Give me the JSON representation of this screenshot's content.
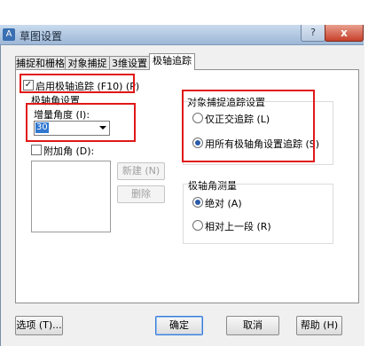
{
  "window": {
    "title": "草图设置",
    "app_icon_glyph": "A",
    "help_glyph": "?",
    "close_glyph": "x"
  },
  "tabs": [
    {
      "label": "捕捉和栅格"
    },
    {
      "label": "对象捕捉"
    },
    {
      "label": "3维设置"
    },
    {
      "label": "极轴追踪"
    }
  ],
  "active_tab": "极轴追踪",
  "polar": {
    "enable_label": "启用极轴追踪 (F10) (P)",
    "enable_checked": true,
    "check_glyph": "✓",
    "angle_settings_group": "极轴角设置",
    "increment_label": "增量角度 (I):",
    "increment_value": "30",
    "additional_label": "附加角 (D):",
    "additional_checked": false,
    "new_button": "新建 (N)",
    "delete_button": "删除"
  },
  "object_snap_tracking": {
    "group_label": "对象捕捉追踪设置",
    "orthogonal_label": "仅正交追踪 (L)",
    "all_polar_label": "用所有极轴角设置追踪 (S)",
    "selected": "all_polar"
  },
  "polar_measurement": {
    "group_label": "极轴角测量",
    "absolute_label": "绝对 (A)",
    "relative_label": "相对上一段 (R)",
    "selected": "absolute"
  },
  "footer": {
    "options_button": "选项 (T)...",
    "ok_button": "确定",
    "cancel_button": "取消",
    "help_button": "帮助 (H)"
  },
  "colors": {
    "highlight_box": "#e01818",
    "selection": "#3078d0",
    "titlebar": "#9db7d6",
    "close_button": "#c7402a"
  }
}
